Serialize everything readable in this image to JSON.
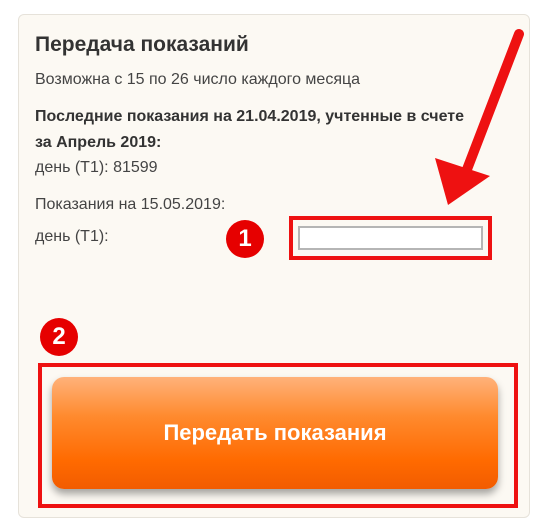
{
  "form": {
    "title": "Передача показаний",
    "availability": "Возможна с 15 по 26 число каждого месяца",
    "last_readings_heading": "Последние показания на 21.04.2019, учтенные в счете за Апрель 2019:",
    "last_reading_value": "день (Т1): 81599",
    "new_readings_heading": "Показания на 15.05.2019:",
    "field_label": "день (Т1):",
    "field_value": "",
    "submit_label": "Передать показания"
  },
  "annotations": {
    "step1": "1",
    "step2": "2",
    "color": "#e60000"
  },
  "colors": {
    "button_top": "#ffb27a",
    "button_bottom": "#f25c00",
    "card_bg": "#fcf9f3"
  }
}
